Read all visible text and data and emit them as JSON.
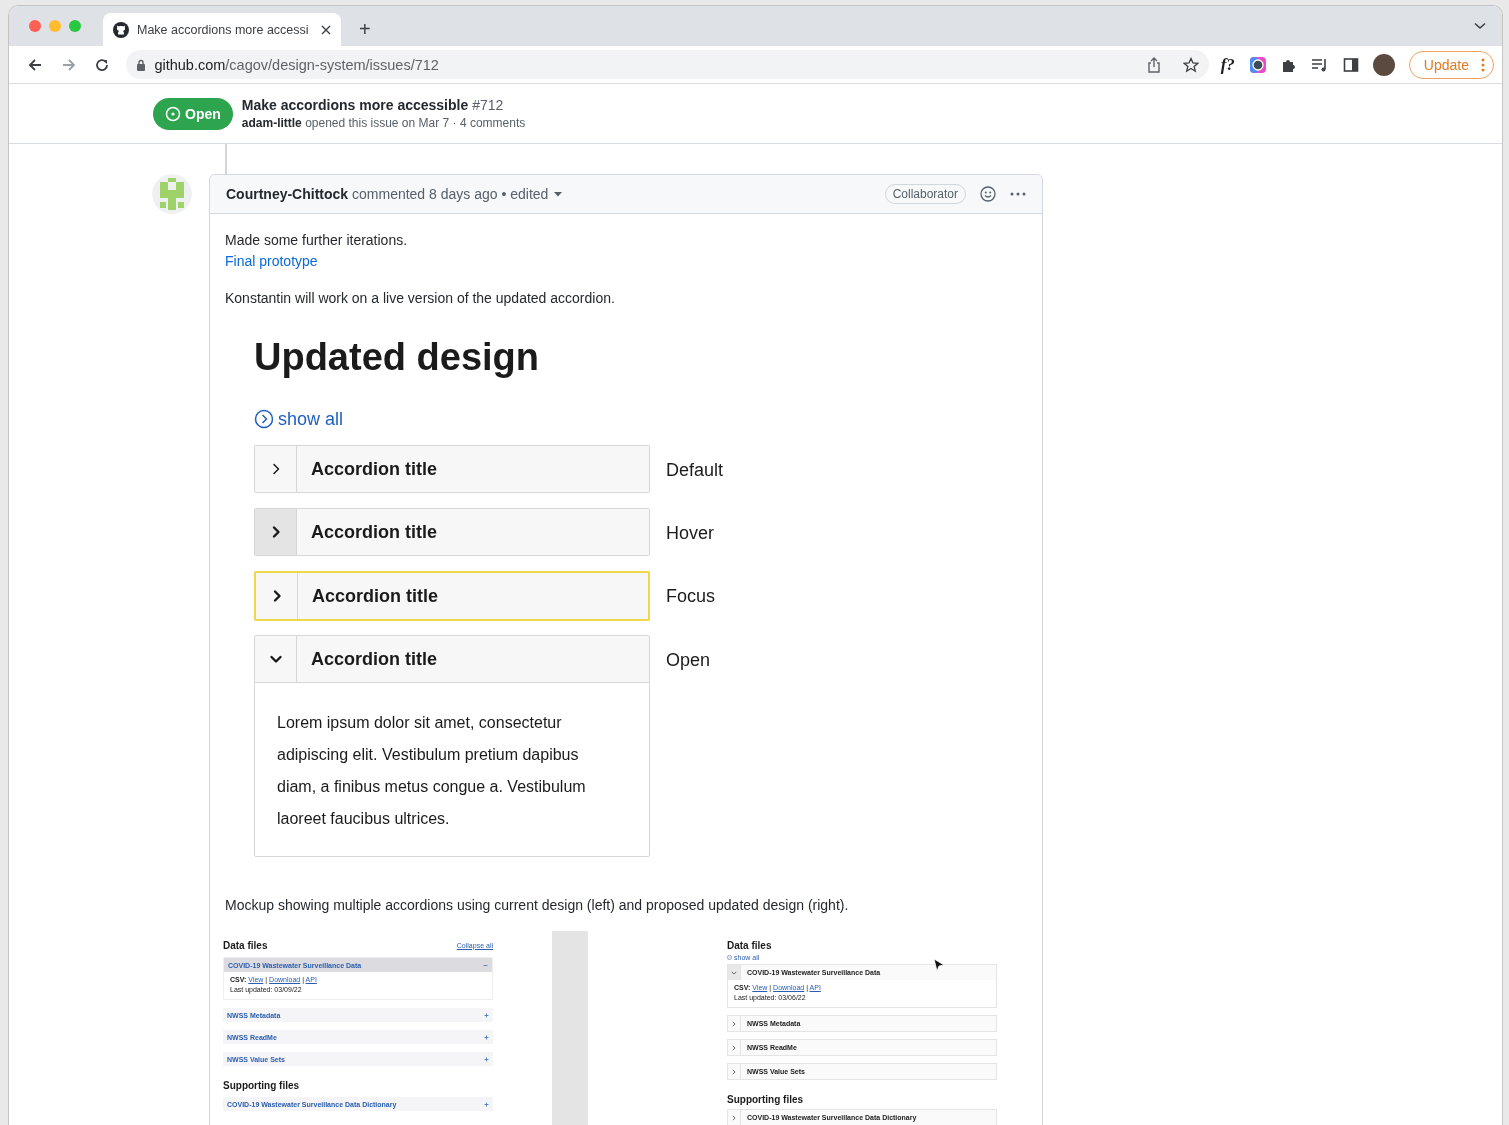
{
  "browser": {
    "tab": {
      "title": "Make accordions more accessi",
      "selected": true
    },
    "new_tab": "+",
    "url": {
      "host": "github.com",
      "path": "/cagov/design-system/issues/712"
    },
    "extension_label": "f?",
    "update_button": "Update"
  },
  "issue_header": {
    "state": "Open",
    "title": "Make accordions more accessible",
    "number": "#712",
    "author": "adam-little",
    "meta": "opened this issue on Mar 7 · 4 comments"
  },
  "comment": {
    "author": "Courtney-Chittock",
    "meta": "commented 8 days ago • edited",
    "badge": "Collaborator",
    "intro": "Made some further iterations.",
    "link": "Final prototype",
    "note": "Konstantin will work on a live version of the updated accordion.",
    "design": {
      "heading": "Updated design",
      "show_all": "show all",
      "accordions": [
        {
          "title": "Accordion title",
          "kind": "default",
          "expanded": false,
          "label": "Default"
        },
        {
          "title": "Accordion title",
          "kind": "hover",
          "expanded": false,
          "label": "Hover"
        },
        {
          "title": "Accordion title",
          "kind": "focus",
          "expanded": false,
          "label": "Focus"
        },
        {
          "title": "Accordion title",
          "kind": "default",
          "expanded": true,
          "label": "Open",
          "body": "Lorem ipsum dolor sit amet, consectetur adipiscing elit. Vestibulum pretium dapibus diam, a finibus metus congue a. Vestibulum laoreet faucibus ultrices."
        }
      ]
    },
    "caption": "Mockup showing multiple accordions using current design (left) and proposed updated design (right).",
    "mockups": [
      {
        "kind": "current",
        "toggle_link": "Collapse all",
        "sections": [
          {
            "heading": "Data files",
            "items": [
              {
                "title": "COVID-19 Wastewater Surveillance Data",
                "expanded": true,
                "body": {
                  "label": "CSV:",
                  "links": [
                    "View",
                    "Download",
                    "API"
                  ],
                  "separator": "|",
                  "updated": "Last updated: 03/09/22"
                }
              },
              {
                "title": "NWSS Metadata",
                "expanded": false
              },
              {
                "title": "NWSS ReadMe",
                "expanded": false
              },
              {
                "title": "NWSS Value Sets",
                "expanded": false
              }
            ]
          },
          {
            "heading": "Supporting files",
            "items": [
              {
                "title": "COVID-19 Wastewater Surveillance Data Dictionary",
                "expanded": false
              }
            ]
          }
        ]
      },
      {
        "kind": "proposed",
        "toggle_link": "show all",
        "sections": [
          {
            "heading": "Data files",
            "items": [
              {
                "title": "COVID-19 Wastewater Surveillance Data",
                "expanded": true,
                "body": {
                  "label": "CSV:",
                  "links": [
                    "View",
                    "Download",
                    "API"
                  ],
                  "separator": "|",
                  "updated": "Last updated: 03/06/22"
                }
              },
              {
                "title": "NWSS Metadata",
                "expanded": false
              },
              {
                "title": "NWSS ReadMe",
                "expanded": false
              },
              {
                "title": "NWSS Value Sets",
                "expanded": false
              }
            ]
          },
          {
            "heading": "Supporting files",
            "items": [
              {
                "title": "COVID-19 Wastewater Surveillance Data Dictionary",
                "expanded": false
              }
            ]
          }
        ]
      }
    ]
  }
}
